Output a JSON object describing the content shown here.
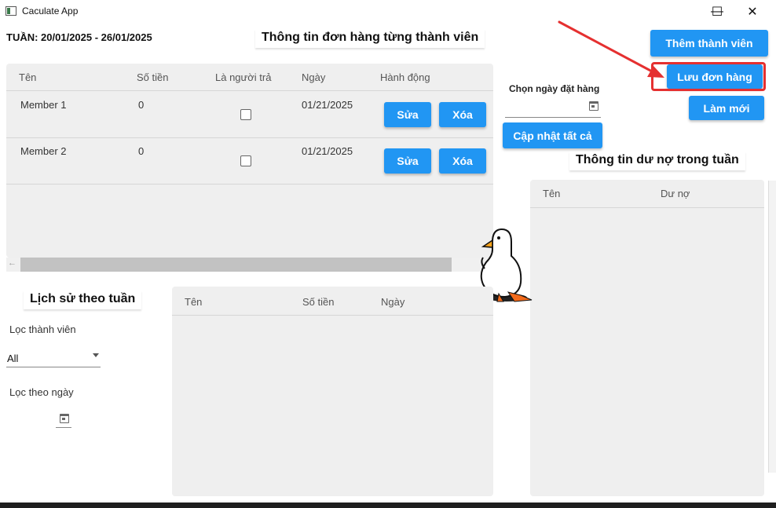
{
  "window": {
    "title": "Caculate App",
    "minimize": "—",
    "maximize": "☐",
    "close": "✕"
  },
  "week_label": "TUẦN: 20/01/2025 - 26/01/2025",
  "orders": {
    "title": "Thông tin đơn hàng từng thành viên",
    "headers": [
      "Tên",
      "Số tiền",
      "Là người trả",
      "Ngày",
      "Hành động"
    ],
    "rows": [
      {
        "name": "Member 1",
        "amount": "0",
        "is_payer": false,
        "date": "01/21/2025",
        "edit": "Sửa",
        "delete": "Xóa"
      },
      {
        "name": "Member 2",
        "amount": "0",
        "is_payer": false,
        "date": "01/21/2025",
        "edit": "Sửa",
        "delete": "Xóa"
      }
    ]
  },
  "order_date": {
    "label": "Chọn ngày đặt hàng",
    "update_all": "Cập nhật tất cả"
  },
  "actions": {
    "add_member": "Thêm thành viên",
    "save_order": "Lưu đơn hàng",
    "refresh": "Làm mới"
  },
  "debt": {
    "title": "Thông tin dư nợ trong tuần",
    "headers": [
      "Tên",
      "Dư nợ"
    ]
  },
  "history": {
    "title": "Lịch sử theo tuần",
    "filter_member_label": "Lọc thành viên",
    "filter_member_value": "All",
    "filter_date_label": "Lọc theo ngày",
    "headers": [
      "Tên",
      "Số tiền",
      "Ngày"
    ]
  },
  "icons": {
    "calendar": "calendar-icon",
    "dropdown": "chevron-down-icon",
    "scroll_left": "scroll-left-icon"
  },
  "colors": {
    "accent": "#2196f3",
    "highlight": "#e53030",
    "panel": "#efefef"
  }
}
